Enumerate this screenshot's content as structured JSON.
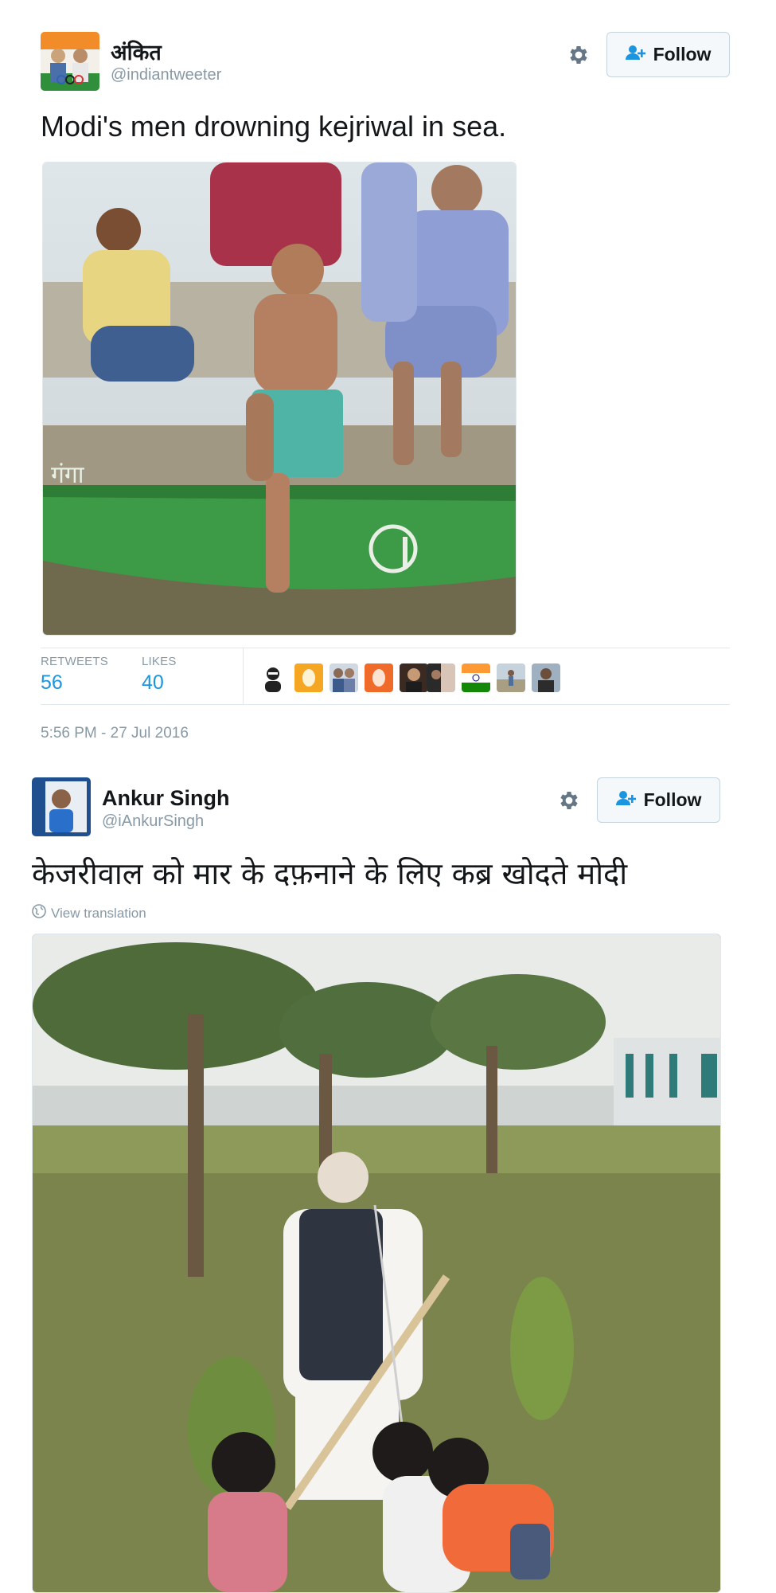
{
  "tweet1": {
    "display_name": "अंकित",
    "handle": "@indiantweeter",
    "follow_label": "Follow",
    "text": "Modi's men drowning kejriwal in sea.",
    "boat_text": "गंगा",
    "stats": {
      "retweets_label": "RETWEETS",
      "retweets_value": "56",
      "likes_label": "LIKES",
      "likes_value": "40"
    },
    "likers": [
      "liker-avatar-1",
      "liker-avatar-2",
      "liker-avatar-3",
      "liker-avatar-4",
      "liker-avatar-5",
      "liker-avatar-6",
      "liker-avatar-7-flag",
      "liker-avatar-8",
      "liker-avatar-9"
    ],
    "timestamp": "5:56 PM - 27 Jul 2016"
  },
  "tweet2": {
    "display_name": "Ankur Singh",
    "handle": "@iAnkurSingh",
    "follow_label": "Follow",
    "text": "केजरीवाल को मार के दफ़नाने के लिए कब्र खोदते मोदी",
    "view_translation": "View translation"
  },
  "icons": {
    "gear": "gear-icon",
    "follow": "add-user-icon",
    "globe": "globe-icon"
  },
  "colors": {
    "accent": "#1b95e0",
    "muted": "#8899a6",
    "follow_bg": "#f5f8fa",
    "boat_green": "#3d9a46",
    "divider": "#e1e8ed"
  }
}
